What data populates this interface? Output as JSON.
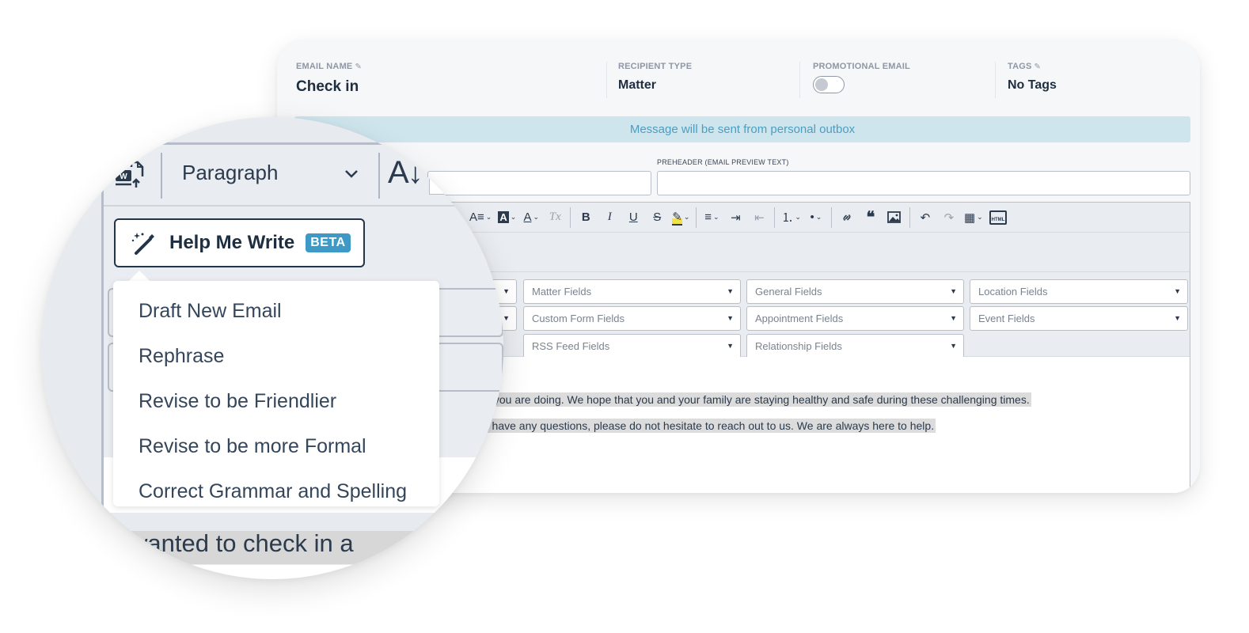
{
  "email": {
    "name_label": "EMAIL NAME",
    "name_value": "Check in",
    "recipient_label": "RECIPIENT TYPE",
    "recipient_value": "Matter",
    "promotional_label": "PROMOTIONAL EMAIL",
    "promotional_on": false,
    "tags_label": "TAGS",
    "tags_value": "No Tags",
    "edit_icon": "✎"
  },
  "notice": "Message will be sent from personal outbox",
  "preheader": {
    "label": "PREHEADER (EMAIL PREVIEW TEXT)",
    "value": "",
    "subject_value": ""
  },
  "toolbar": {
    "font_size": "A≡",
    "bg_color": "A",
    "text_color": "A",
    "clear_format": "Tx",
    "bold": "B",
    "italic": "I",
    "underline": "U",
    "strike": "S",
    "highlight": "✎",
    "align": "≡",
    "indent": "⇥",
    "outdent": "⇤",
    "ordered_list": "⒈",
    "bullet_list": "•",
    "link": "🔗",
    "quote": "❝",
    "image": "▣",
    "undo": "↶",
    "redo": "↷",
    "table": "▦",
    "html": "HTML",
    "caret": "⌄"
  },
  "merge_fields": {
    "row1": [
      "Matter Fields",
      "General Fields",
      "Location Fields"
    ],
    "row2": [
      "Custom Form Fields",
      "Appointment Fields",
      "Event Fields"
    ],
    "row3": [
      "RSS Feed Fields",
      "Relationship Fields"
    ],
    "arrow": "▼"
  },
  "body": {
    "line1": "v you are doing. We hope that you and your family are staying healthy and safe during these challenging times.",
    "line2": "r have any questions, please do not hesitate to reach out to us. We are always here to help."
  },
  "magnifier": {
    "paragraph_select": "Paragraph",
    "ai_glyph": "A↓",
    "help_me_write": "Help Me Write",
    "beta_badge": "BETA",
    "menu_items": [
      "Draft New Email",
      "Rephrase",
      "Revise to be Friendlier",
      "Revise to be more Formal",
      "Correct Grammar and Spelling"
    ],
    "body_snippet": "wanted to check in a"
  },
  "colors": {
    "accent": "#3f99c6",
    "notice_bg": "#cfe5ed",
    "notice_text": "#4b9ec1",
    "text_dark": "#1e2d3f"
  }
}
